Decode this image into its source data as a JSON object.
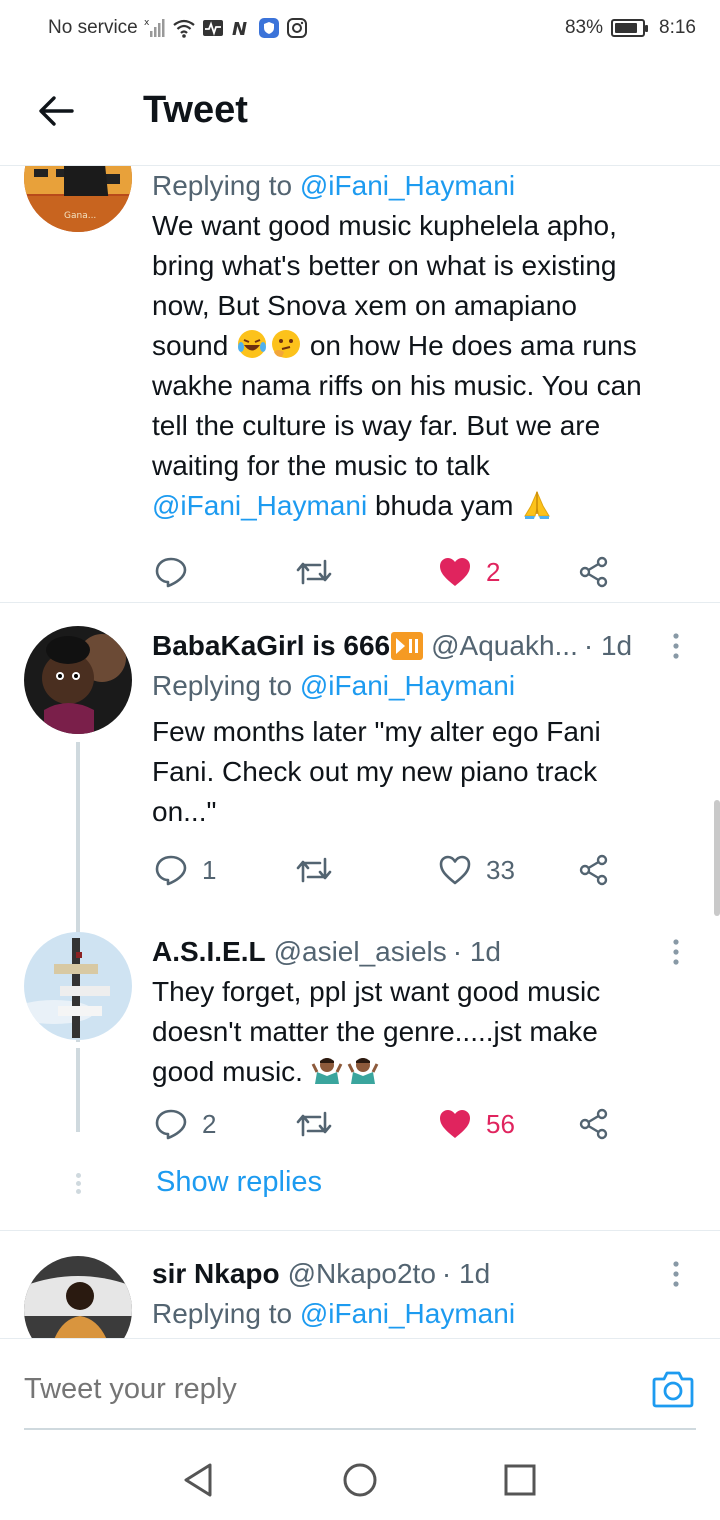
{
  "status_bar": {
    "carrier": "No service",
    "battery": "83%",
    "battery_level": 0.83,
    "time": "8:16"
  },
  "header": {
    "title": "Tweet"
  },
  "tweets": [
    {
      "reply_prefix": "Replying to ",
      "reply_to": "@iFani_Haymani",
      "text_lines": [
        "We want good music kuphelela apho,",
        "bring what's better on what is existing",
        "now, But Snova xem on amapiano"
      ],
      "text_line4_a": "sound ",
      "text_line4_b": " on how He does ama runs",
      "text_lines2": [
        "wakhe nama riffs on his music. You can",
        "tell the culture is way far. But we are",
        "waiting for the music to talk"
      ],
      "mention_end": "@iFani_Haymani",
      "text_end": " bhuda yam ",
      "likes": "2",
      "liked": true
    },
    {
      "display_name": "BabaKaGirl is 666",
      "handle": "@Aquakh...",
      "time": "· 1d",
      "reply_prefix": "Replying to ",
      "reply_to": "@iFani_Haymani",
      "text_lines": [
        "Few months later \"my alter ego Fani",
        "Fani. Check out my new piano track",
        "on...\""
      ],
      "replies": "1",
      "likes": "33",
      "liked": false
    },
    {
      "display_name": "A.S.I.E.L",
      "handle": "@asiel_asiels",
      "time": "· 1d",
      "text_lines": [
        "They forget, ppl jst want good music",
        "doesn't matter the genre.....jst make"
      ],
      "text_line3": "good music. ",
      "replies": "2",
      "likes": "56",
      "liked": true
    },
    {
      "display_name": "sir Nkapo",
      "handle": "@Nkapo2to",
      "time": "· 1d",
      "reply_prefix": "Replying to ",
      "reply_to": "@iFani_Haymani"
    }
  ],
  "show_replies": "Show replies",
  "reply_bar": {
    "placeholder": "Tweet your reply"
  },
  "colors": {
    "accent": "#1d9bf0",
    "like": "#e0245e",
    "text_secondary": "#536471"
  }
}
